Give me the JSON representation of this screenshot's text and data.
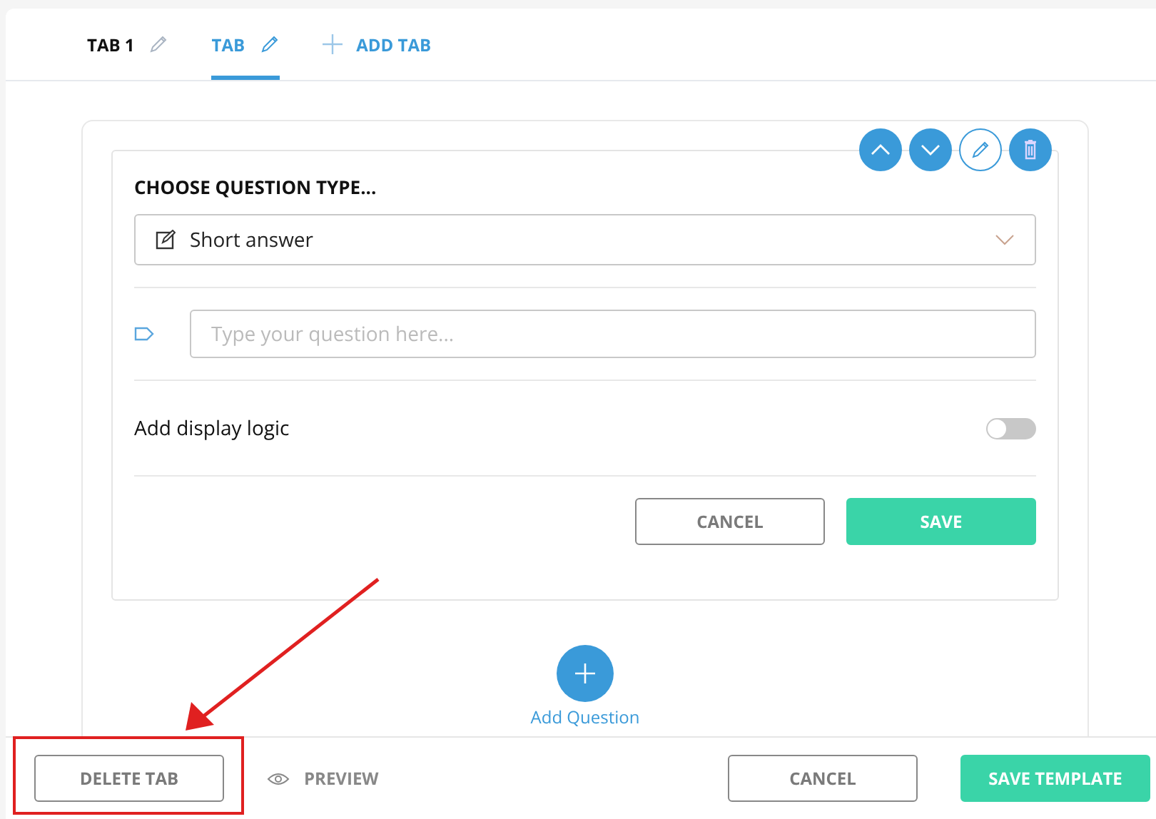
{
  "tabs": [
    {
      "label": "TAB 1",
      "selected": false
    },
    {
      "label": "TAB",
      "selected": true
    }
  ],
  "add_tab": "ADD TAB",
  "question": {
    "heading": "CHOOSE QUESTION TYPE...",
    "type": "Short answer",
    "placeholder": "Type your question here...",
    "display_logic": {
      "label": "Add display logic",
      "on": false
    },
    "buttons": [
      {
        "label": "CANCEL",
        "kind": "outline"
      },
      {
        "label": "SAVE",
        "kind": "primary"
      }
    ]
  },
  "add_question": "Add Question",
  "footer": {
    "delete": "DELETE TAB",
    "preview": "PREVIEW",
    "buttons": [
      {
        "label": "CANCEL",
        "kind": "outline"
      },
      {
        "label": "SAVE TEMPLATE",
        "kind": "primary"
      }
    ]
  }
}
